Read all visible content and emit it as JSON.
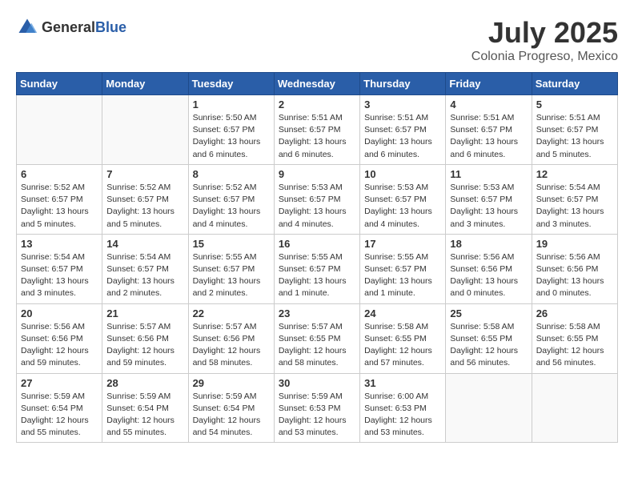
{
  "header": {
    "logo_general": "General",
    "logo_blue": "Blue",
    "month": "July 2025",
    "location": "Colonia Progreso, Mexico"
  },
  "weekdays": [
    "Sunday",
    "Monday",
    "Tuesday",
    "Wednesday",
    "Thursday",
    "Friday",
    "Saturday"
  ],
  "weeks": [
    [
      {
        "day": "",
        "info": ""
      },
      {
        "day": "",
        "info": ""
      },
      {
        "day": "1",
        "info": "Sunrise: 5:50 AM\nSunset: 6:57 PM\nDaylight: 13 hours\nand 6 minutes."
      },
      {
        "day": "2",
        "info": "Sunrise: 5:51 AM\nSunset: 6:57 PM\nDaylight: 13 hours\nand 6 minutes."
      },
      {
        "day": "3",
        "info": "Sunrise: 5:51 AM\nSunset: 6:57 PM\nDaylight: 13 hours\nand 6 minutes."
      },
      {
        "day": "4",
        "info": "Sunrise: 5:51 AM\nSunset: 6:57 PM\nDaylight: 13 hours\nand 6 minutes."
      },
      {
        "day": "5",
        "info": "Sunrise: 5:51 AM\nSunset: 6:57 PM\nDaylight: 13 hours\nand 5 minutes."
      }
    ],
    [
      {
        "day": "6",
        "info": "Sunrise: 5:52 AM\nSunset: 6:57 PM\nDaylight: 13 hours\nand 5 minutes."
      },
      {
        "day": "7",
        "info": "Sunrise: 5:52 AM\nSunset: 6:57 PM\nDaylight: 13 hours\nand 5 minutes."
      },
      {
        "day": "8",
        "info": "Sunrise: 5:52 AM\nSunset: 6:57 PM\nDaylight: 13 hours\nand 4 minutes."
      },
      {
        "day": "9",
        "info": "Sunrise: 5:53 AM\nSunset: 6:57 PM\nDaylight: 13 hours\nand 4 minutes."
      },
      {
        "day": "10",
        "info": "Sunrise: 5:53 AM\nSunset: 6:57 PM\nDaylight: 13 hours\nand 4 minutes."
      },
      {
        "day": "11",
        "info": "Sunrise: 5:53 AM\nSunset: 6:57 PM\nDaylight: 13 hours\nand 3 minutes."
      },
      {
        "day": "12",
        "info": "Sunrise: 5:54 AM\nSunset: 6:57 PM\nDaylight: 13 hours\nand 3 minutes."
      }
    ],
    [
      {
        "day": "13",
        "info": "Sunrise: 5:54 AM\nSunset: 6:57 PM\nDaylight: 13 hours\nand 3 minutes."
      },
      {
        "day": "14",
        "info": "Sunrise: 5:54 AM\nSunset: 6:57 PM\nDaylight: 13 hours\nand 2 minutes."
      },
      {
        "day": "15",
        "info": "Sunrise: 5:55 AM\nSunset: 6:57 PM\nDaylight: 13 hours\nand 2 minutes."
      },
      {
        "day": "16",
        "info": "Sunrise: 5:55 AM\nSunset: 6:57 PM\nDaylight: 13 hours\nand 1 minute."
      },
      {
        "day": "17",
        "info": "Sunrise: 5:55 AM\nSunset: 6:57 PM\nDaylight: 13 hours\nand 1 minute."
      },
      {
        "day": "18",
        "info": "Sunrise: 5:56 AM\nSunset: 6:56 PM\nDaylight: 13 hours\nand 0 minutes."
      },
      {
        "day": "19",
        "info": "Sunrise: 5:56 AM\nSunset: 6:56 PM\nDaylight: 13 hours\nand 0 minutes."
      }
    ],
    [
      {
        "day": "20",
        "info": "Sunrise: 5:56 AM\nSunset: 6:56 PM\nDaylight: 12 hours\nand 59 minutes."
      },
      {
        "day": "21",
        "info": "Sunrise: 5:57 AM\nSunset: 6:56 PM\nDaylight: 12 hours\nand 59 minutes."
      },
      {
        "day": "22",
        "info": "Sunrise: 5:57 AM\nSunset: 6:56 PM\nDaylight: 12 hours\nand 58 minutes."
      },
      {
        "day": "23",
        "info": "Sunrise: 5:57 AM\nSunset: 6:55 PM\nDaylight: 12 hours\nand 58 minutes."
      },
      {
        "day": "24",
        "info": "Sunrise: 5:58 AM\nSunset: 6:55 PM\nDaylight: 12 hours\nand 57 minutes."
      },
      {
        "day": "25",
        "info": "Sunrise: 5:58 AM\nSunset: 6:55 PM\nDaylight: 12 hours\nand 56 minutes."
      },
      {
        "day": "26",
        "info": "Sunrise: 5:58 AM\nSunset: 6:55 PM\nDaylight: 12 hours\nand 56 minutes."
      }
    ],
    [
      {
        "day": "27",
        "info": "Sunrise: 5:59 AM\nSunset: 6:54 PM\nDaylight: 12 hours\nand 55 minutes."
      },
      {
        "day": "28",
        "info": "Sunrise: 5:59 AM\nSunset: 6:54 PM\nDaylight: 12 hours\nand 55 minutes."
      },
      {
        "day": "29",
        "info": "Sunrise: 5:59 AM\nSunset: 6:54 PM\nDaylight: 12 hours\nand 54 minutes."
      },
      {
        "day": "30",
        "info": "Sunrise: 5:59 AM\nSunset: 6:53 PM\nDaylight: 12 hours\nand 53 minutes."
      },
      {
        "day": "31",
        "info": "Sunrise: 6:00 AM\nSunset: 6:53 PM\nDaylight: 12 hours\nand 53 minutes."
      },
      {
        "day": "",
        "info": ""
      },
      {
        "day": "",
        "info": ""
      }
    ]
  ]
}
